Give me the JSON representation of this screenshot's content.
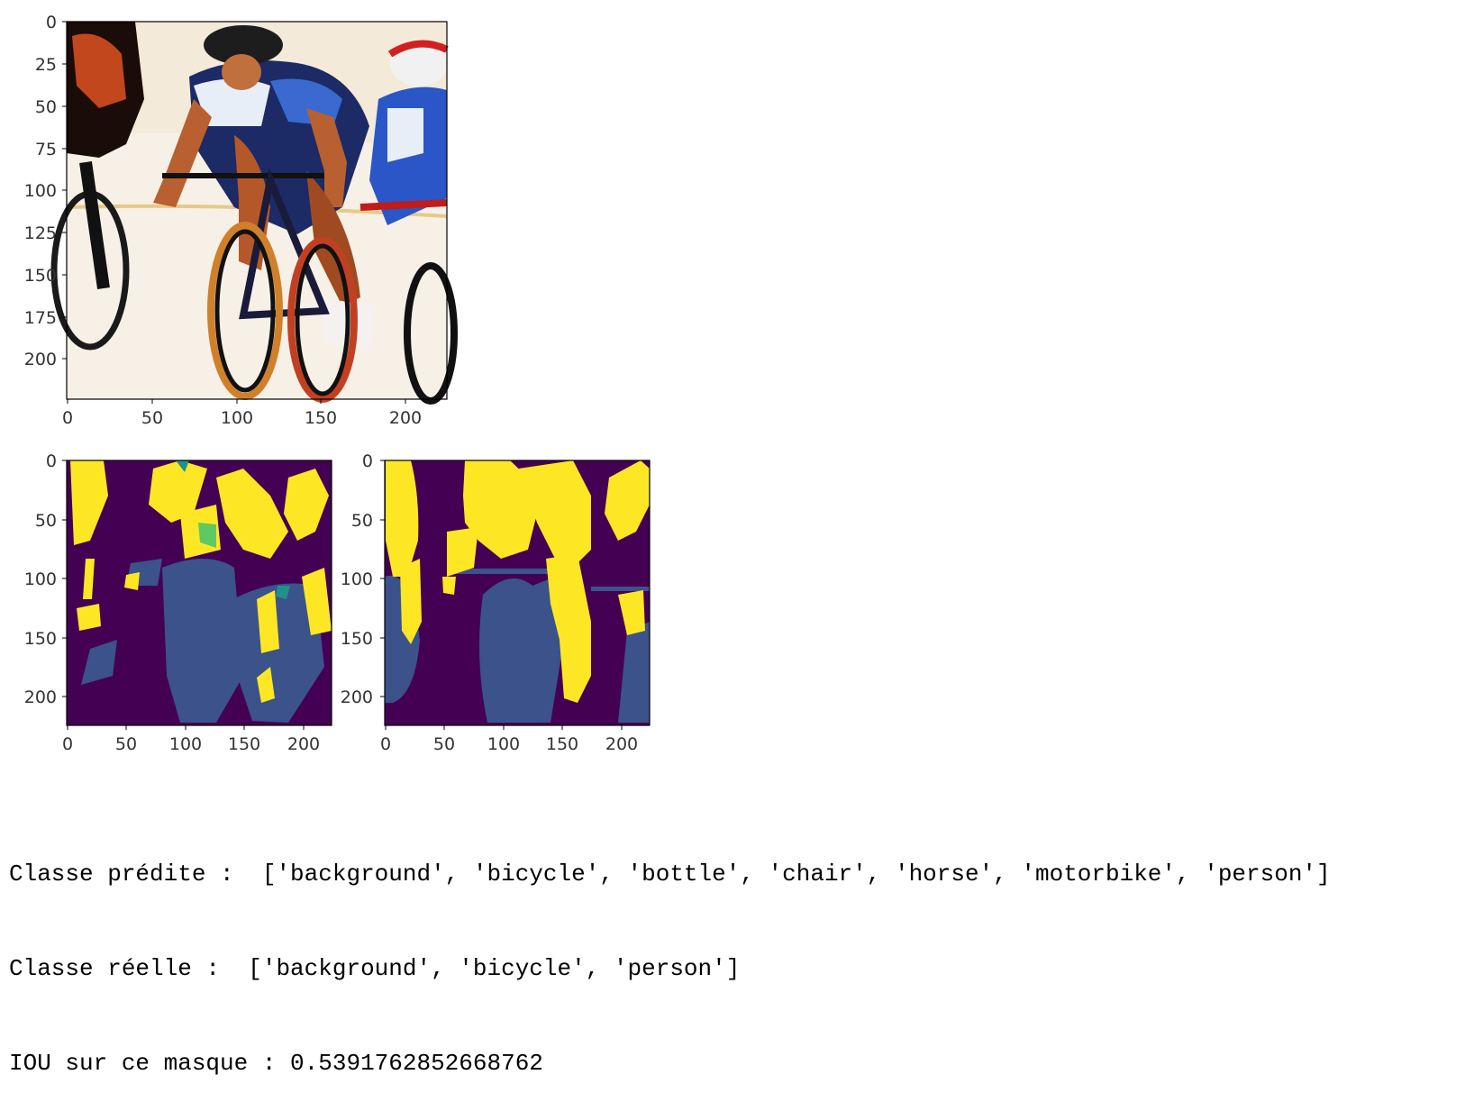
{
  "output": {
    "line1": "Classe prédite :  ['background', 'bicycle', 'bottle', 'chair', 'horse', 'motorbike', 'person']",
    "line2": "Classe réelle :  ['background', 'bicycle', 'person']",
    "line3": "IOU sur ce masque : 0.5391762852668762"
  },
  "colors": {
    "bg_purple": "#440154",
    "class_blue": "#3b528b",
    "class_teal": "#21918c",
    "class_green": "#5ec962",
    "class_yellow": "#fde725"
  },
  "plots": {
    "image": {
      "yticks": [
        "0",
        "25",
        "50",
        "75",
        "100",
        "125",
        "150",
        "175",
        "200"
      ],
      "xticks": [
        "0",
        "50",
        "100",
        "150",
        "200"
      ],
      "content": "input-photo-cyclists"
    },
    "pred_mask": {
      "yticks": [
        "0",
        "50",
        "100",
        "150",
        "200"
      ],
      "xticks": [
        "0",
        "50",
        "100",
        "150",
        "200"
      ],
      "content": "predicted-segmentation-mask"
    },
    "true_mask": {
      "yticks": [
        "0",
        "50",
        "100",
        "150",
        "200"
      ],
      "xticks": [
        "0",
        "50",
        "100",
        "150",
        "200"
      ],
      "content": "ground-truth-segmentation-mask"
    }
  }
}
